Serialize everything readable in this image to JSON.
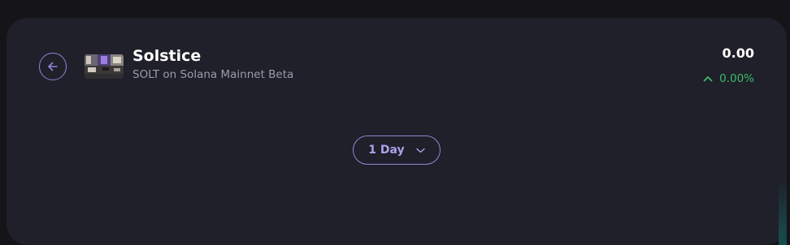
{
  "header": {
    "back_icon": "arrow-left-icon",
    "token": {
      "name": "Solstice",
      "subtitle": "SOLT on Solana Mainnet Beta"
    },
    "price": {
      "value": "0.00",
      "change": "0.00%",
      "change_direction_icon": "chevron-up-icon"
    }
  },
  "period_selector": {
    "selected": "1 Day",
    "icon": "chevron-down-icon"
  },
  "colors": {
    "page_background": "#151419",
    "card_background": "#1f2029",
    "accent": "#8f86d8",
    "positive": "#3dbb6a",
    "muted_text": "#9a9cab"
  }
}
